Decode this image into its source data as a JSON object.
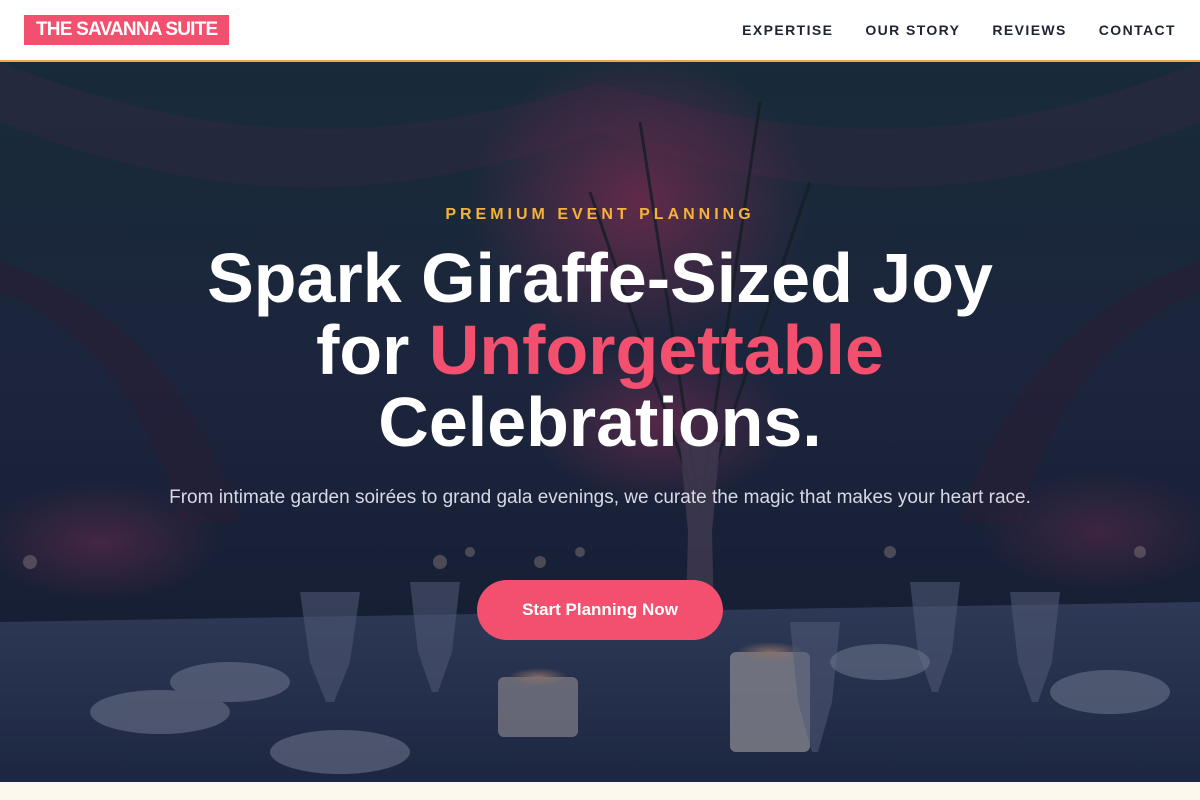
{
  "brand": {
    "name": "THE SAVANNA SUITE",
    "color": "#f2506e"
  },
  "nav": {
    "items": [
      {
        "label": "EXPERTISE"
      },
      {
        "label": "OUR STORY"
      },
      {
        "label": "REVIEWS"
      },
      {
        "label": "CONTACT"
      }
    ],
    "accent_border": "#f4a640"
  },
  "hero": {
    "background": "dimly lit banquet table with wine glasses, candles, napkins and a floral centerpiece",
    "eyebrow": "PREMIUM EVENT PLANNING",
    "headline": {
      "line1": "Spark Giraffe-Sized Joy",
      "line2_lead": "for ",
      "line2_accent": "Unforgettable",
      "line3": "Celebrations."
    },
    "subheading": "From intimate garden soirées to grand gala evenings, we curate the magic that makes your heart race.",
    "cta_label": "Start Planning Now",
    "accent_color": "#f2506e",
    "eyebrow_color": "#f4b43a"
  }
}
